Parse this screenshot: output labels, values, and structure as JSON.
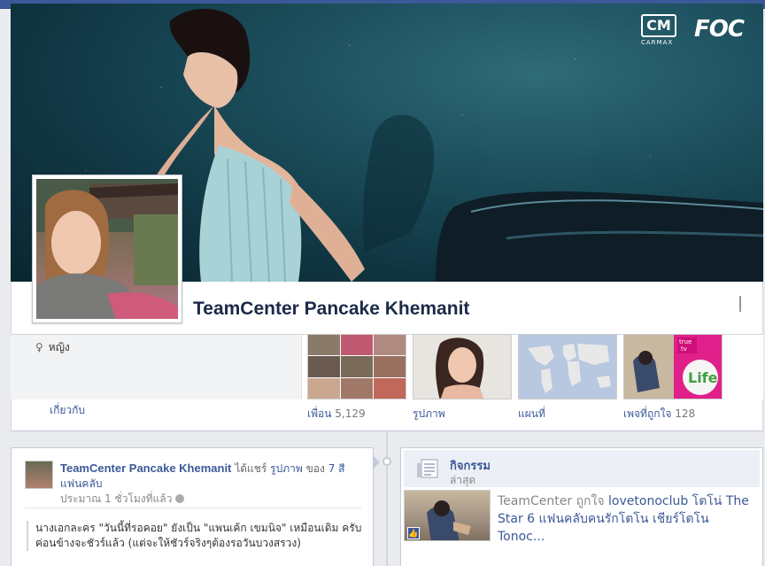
{
  "cover": {
    "logo_left": "CARMAX",
    "logo_left_mark": "CM",
    "logo_right": "FOC"
  },
  "profile": {
    "name": "TeamCenter Pancake Khemanit"
  },
  "info": {
    "gender": "หญิง",
    "gender_symbol": "♀",
    "about_link": "เกี่ยวกับ"
  },
  "nav": {
    "friends_label": "เพื่อน",
    "friends_count": "5,129",
    "photos_label": "รูปภาพ",
    "map_label": "แผนที่",
    "likes_label": "เพจที่ถูกใจ",
    "likes_count": "128"
  },
  "post": {
    "author": "TeamCenter Pancake Khemanit",
    "action_pre": " ได้แชร์ ",
    "action_link": "รูปภาพ",
    "action_mid": " ของ ",
    "action_target": "7 สี แฟนคลับ",
    "time": "ประมาณ 1 ชั่วโมงที่แล้ว",
    "text": "นางเอกละคร \"วันนี้ที่รอคอย\" ยังเป็น \"แพนเค้ก เขมนิจ\" เหมือนเดิม ครับ ค่อนข้างจะชัวร์แล้ว (แต่จะให้ชัวร์จริงๆต้องรอวันบวงสรวง)"
  },
  "activity": {
    "title": "กิจกรรม",
    "subtitle": "ล่าสุด",
    "actor": "TeamCenter",
    "verb": " ถูกใจ ",
    "link": "lovetonoclub โตโน่ The Star 6 แฟนคลับคนรักโตโน เชียร์โตโน Tonoc...",
    "like_icon": "thumbs-up-icon"
  },
  "colors": {
    "brand": "#3b5998",
    "name_text": "#1c2a47",
    "page_bg": "#e9ebee"
  }
}
